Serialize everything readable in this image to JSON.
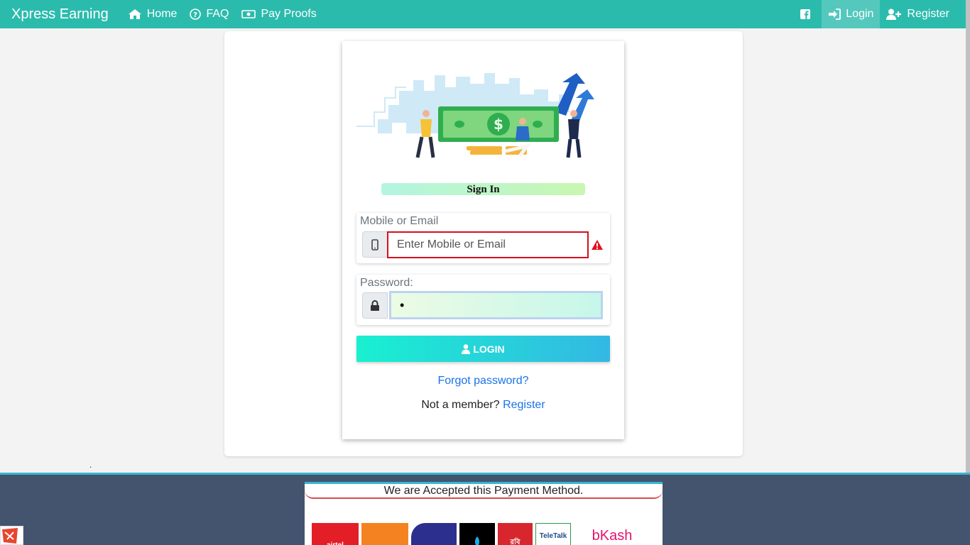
{
  "navbar": {
    "brand": "Xpress Earning",
    "home": "Home",
    "faq": "FAQ",
    "pay_proofs": "Pay Proofs",
    "login": "Login",
    "register": "Register"
  },
  "login_card": {
    "heading": "Sign In",
    "mobile_label": "Mobile or Email",
    "mobile_placeholder": "Enter Mobile or Email",
    "password_label": "Password:",
    "password_value": "•",
    "login_button": "LOGIN",
    "forgot_link": "Forgot password?",
    "not_member": "Not a member?",
    "register_link": "Register"
  },
  "misc": {
    "dot": "."
  },
  "footer": {
    "payment_title": "We are Accepted this Payment Method.",
    "logos": [
      {
        "name": "airtel",
        "text": "airtel",
        "color": "#e41e26"
      },
      {
        "name": "banglalink",
        "text": "",
        "color": "#f58220"
      },
      {
        "name": "rocket",
        "text": "",
        "color": "#2d2f8f"
      },
      {
        "name": "grameenphone",
        "text": "",
        "color": "#000000"
      },
      {
        "name": "robi",
        "text": "রবি",
        "color": "#d7262d"
      },
      {
        "name": "teletalk",
        "text": "TeleTalk",
        "color": "#ffffff"
      },
      {
        "name": "bkash",
        "text": "bKash",
        "color": "#ffffff"
      }
    ]
  },
  "colors": {
    "accent": "#2bbbad",
    "error": "#d4101e",
    "link": "#1a73e8",
    "footer_bg": "#44546f"
  }
}
